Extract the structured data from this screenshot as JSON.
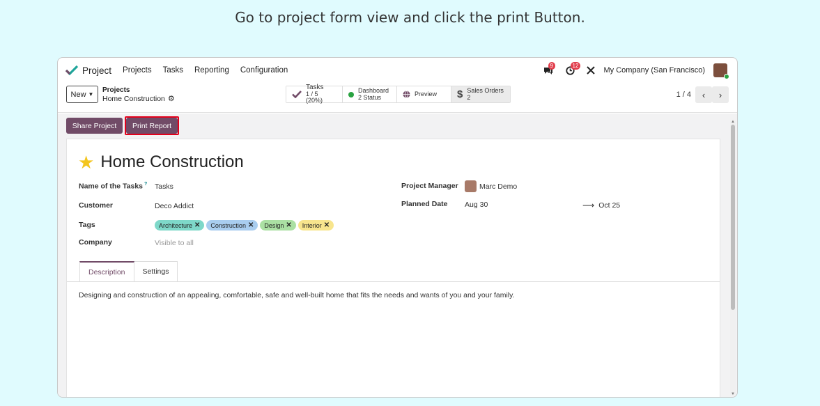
{
  "caption": "Go to project form view and click the print Button.",
  "navbar": {
    "app_name": "Project",
    "menu": [
      "Projects",
      "Tasks",
      "Reporting",
      "Configuration"
    ],
    "messages_count": "9",
    "activities_count": "12",
    "company": "My Company (San Francisco)"
  },
  "control": {
    "new_label": "New",
    "breadcrumb_parent": "Projects",
    "breadcrumb_current": "Home Construction",
    "stats": {
      "tasks_label": "Tasks",
      "tasks_value": "1 / 5 (20%)",
      "dashboard_label": "Dashboard",
      "dashboard_value": "2 Status",
      "preview_label": "Preview",
      "sales_label": "Sales Orders",
      "sales_value": "2"
    },
    "pager": "1 / 4"
  },
  "actions": {
    "share": "Share Project",
    "print": "Print Report"
  },
  "form": {
    "title": "Home Construction",
    "labels": {
      "task_name": "Name of the Tasks",
      "help_mark": "?",
      "customer": "Customer",
      "tags": "Tags",
      "company": "Company",
      "manager": "Project Manager",
      "planned_date": "Planned Date"
    },
    "values": {
      "task_name": "Tasks",
      "customer": "Deco Addict",
      "company": "Visible to all",
      "manager": "Marc Demo",
      "date_start": "Aug 30",
      "date_end": "Oct 25"
    },
    "tags": [
      {
        "label": "Architecture",
        "color": "#7ed8c9"
      },
      {
        "label": "Construction",
        "color": "#a9cdef"
      },
      {
        "label": "Design",
        "color": "#abe0a3"
      },
      {
        "label": "Interior",
        "color": "#f8e58d"
      }
    ],
    "tabs": [
      "Description",
      "Settings"
    ],
    "description": "Designing and construction of an appealing, comfortable, safe and well-built home that fits the needs and wants of you and your family."
  },
  "colors": {
    "brand": "#714b67",
    "highlight": "#e3001b",
    "badge": "#e23f4d",
    "status_green": "#2aa342"
  }
}
